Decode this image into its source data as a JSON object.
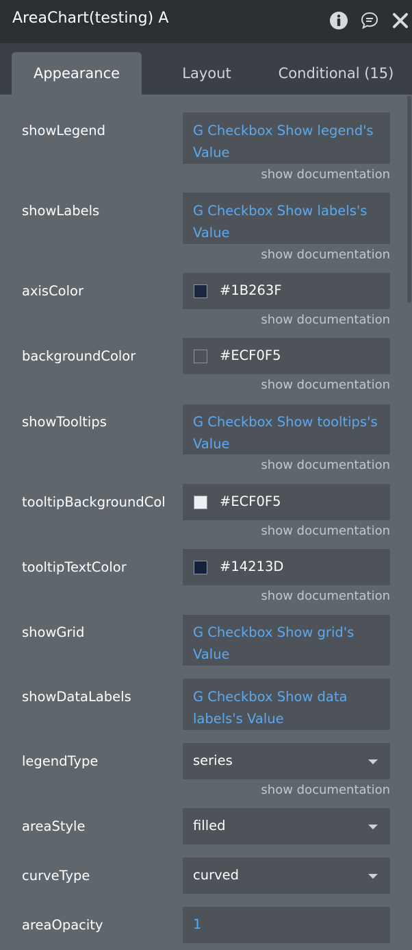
{
  "window": {
    "title": "AreaChart(testing) A"
  },
  "tabs": [
    {
      "label": "Appearance"
    },
    {
      "label": "Layout"
    },
    {
      "label": "Conditional (15)"
    }
  ],
  "doc_link_label": "show documentation",
  "properties": [
    {
      "name": "showLegend",
      "value": "G Checkbox Show legend's Value"
    },
    {
      "name": "showLabels",
      "value": "G Checkbox Show labels's Value"
    },
    {
      "name": "axisColor",
      "value": "#1B263F"
    },
    {
      "name": "backgroundColor",
      "value": "#ECF0F5"
    },
    {
      "name": "showTooltips",
      "value": "G Checkbox Show tooltips's Value"
    },
    {
      "name": "tooltipBackgroundCol",
      "value": "#ECF0F5"
    },
    {
      "name": "tooltipTextColor",
      "value": "#14213D"
    },
    {
      "name": "showGrid",
      "value": "G Checkbox Show grid's Value"
    },
    {
      "name": "showDataLabels",
      "value": "G Checkbox Show data labels's Value"
    },
    {
      "name": "legendType",
      "value": "series"
    },
    {
      "name": "areaStyle",
      "value": "filled"
    },
    {
      "name": "curveType",
      "value": "curved"
    },
    {
      "name": "areaOpacity",
      "value": "1"
    }
  ],
  "swatch_colors": {
    "axisColor": "#1B263F",
    "backgroundColor": "#4D5358",
    "tooltipBackgroundCol": "#ECF0F5",
    "tooltipTextColor": "#14213D"
  },
  "colors": {
    "panel": "#5F666C",
    "titlebar": "#2B3034",
    "field": "#4D5358",
    "dynamic_value": "#5AA9F2"
  }
}
